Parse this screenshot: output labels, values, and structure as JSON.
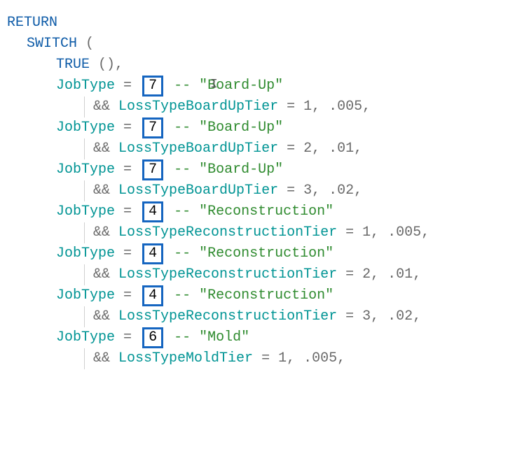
{
  "kw_return": "RETURN",
  "kw_switch": "SWITCH",
  "kw_true": "TRUE",
  "paren_open": "(",
  "paren_close": ")",
  "comma": ",",
  "double_comma": ", ",
  "empty_args": "(),",
  "jobtype": "JobType",
  "eq": "=",
  "and": "&&",
  "dashdash": "--",
  "entries": [
    {
      "jt_val": "7",
      "comment": "\"Board-Up\"",
      "loss_var": "LossTypeBoardUpTier",
      "tier": "1",
      "rate": ".005"
    },
    {
      "jt_val": "7",
      "comment": "\"Board-Up\"",
      "loss_var": "LossTypeBoardUpTier",
      "tier": "2",
      "rate": ".01"
    },
    {
      "jt_val": "7",
      "comment": "\"Board-Up\"",
      "loss_var": "LossTypeBoardUpTier",
      "tier": "3",
      "rate": ".02"
    },
    {
      "jt_val": "4",
      "comment": "\"Reconstruction\"",
      "loss_var": "LossTypeReconstructionTier",
      "tier": "1",
      "rate": ".005"
    },
    {
      "jt_val": "4",
      "comment": "\"Reconstruction\"",
      "loss_var": "LossTypeReconstructionTier",
      "tier": "2",
      "rate": ".01"
    },
    {
      "jt_val": "4",
      "comment": "\"Reconstruction\"",
      "loss_var": "LossTypeReconstructionTier",
      "tier": "3",
      "rate": ".02"
    },
    {
      "jt_val": "6",
      "comment": "\"Mold\"",
      "loss_var": "LossTypeMoldTier",
      "tier": "1",
      "rate": ".005"
    }
  ],
  "cursor_glyph": "I"
}
